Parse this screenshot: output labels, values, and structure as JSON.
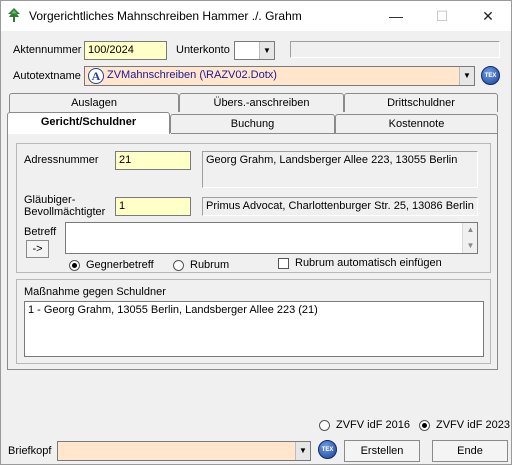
{
  "window": {
    "title": "Vorgerichtliches Mahnschreiben Hammer ./. Grahm",
    "minimize": "—",
    "maximize": "☐",
    "close": "✕"
  },
  "header": {
    "aktennummer_label": "Aktennummer",
    "aktennummer_value": "100/2024",
    "unterkonto_label": "Unterkonto",
    "unterkonto_value": "",
    "unterkonto_arrow": "▼",
    "autotext_label": "Autotextname",
    "autotext_value": "ZVMahnschreiben (\\RAZV02.Dotx)",
    "autotext_icon_letter": "A",
    "autotext_arrow": "▼",
    "tex_label": "TEX"
  },
  "tabs": {
    "row1": [
      "Auslagen",
      "Übers.-anschreiben",
      "Drittschuldner"
    ],
    "row2": [
      "Gericht/Schuldner",
      "Buchung",
      "Kostennote"
    ]
  },
  "form": {
    "adressnummer_label": "Adressnummer",
    "adressnummer_value": "21",
    "adressnummer_display": "Georg Grahm, Landsberger Allee 223, 13055 Berlin",
    "glaeubiger_label_1": "Gläubiger-",
    "glaeubiger_label_2": "Bevollmächtigter",
    "glaeubiger_value": "1",
    "glaeubiger_display": "Primus Advocat, Charlottenburger Str. 25, 13086 Berlin",
    "betreff_label": "Betreff",
    "betreff_button": "->",
    "betreff_value": "",
    "radio_gegner": "Gegnerbetreff",
    "radio_rubrum": "Rubrum",
    "checkbox_rubrum_auto": "Rubrum automatisch einfügen",
    "massnahme_label": "Maßnahme gegen Schuldner",
    "massnahme_items": [
      "1 - Georg Grahm, 13055 Berlin, Landsberger Allee 223 (21)"
    ]
  },
  "bottom": {
    "zvfv_2016": "ZVFV idF 2016",
    "zvfv_2023": "ZVFV idF 2023",
    "briefkopf_label": "Briefkopf",
    "briefkopf_value": "",
    "briefkopf_arrow": "▼",
    "tex_label": "TEX",
    "erstellen_button": "Erstellen",
    "ende_button": "Ende"
  },
  "colors": {
    "required_field": "#ffffc8",
    "autotext_field": "#ffe6cc",
    "brand_icon": "#2e7d32"
  }
}
